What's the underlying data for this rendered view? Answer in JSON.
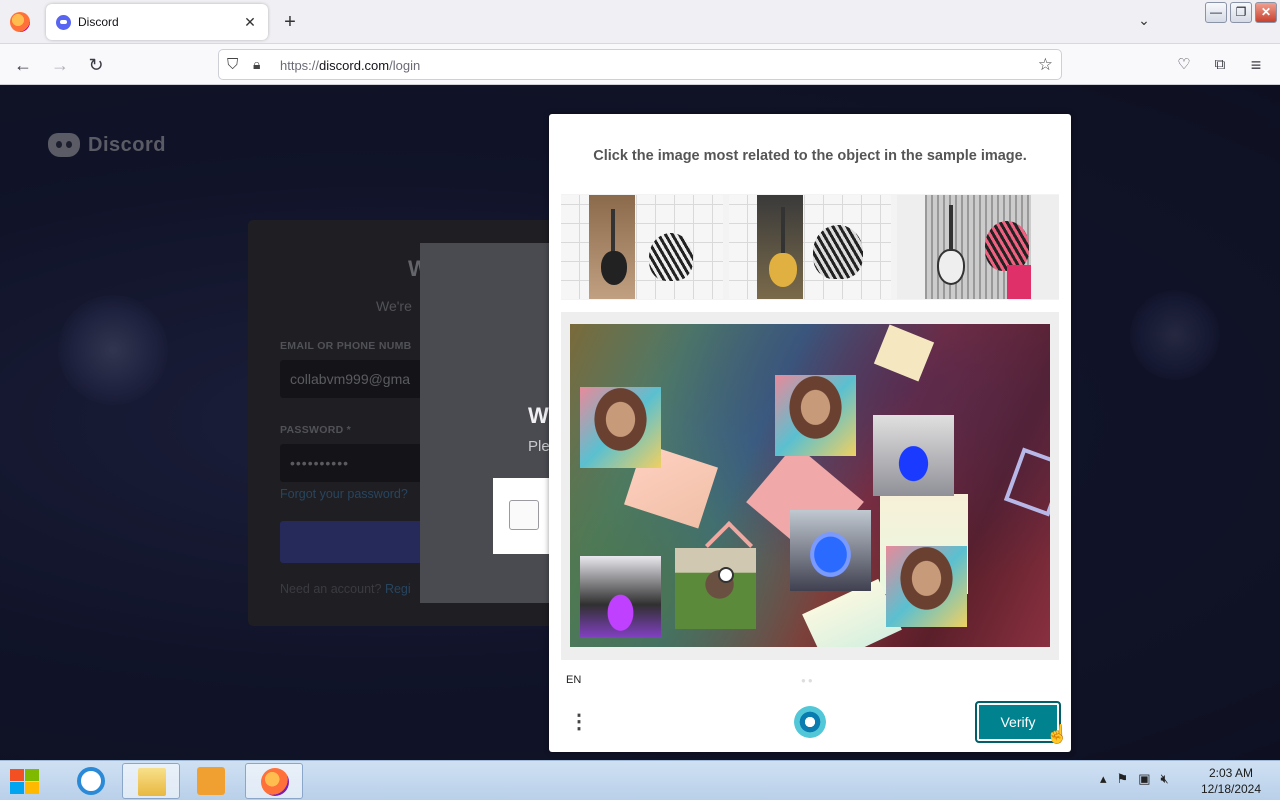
{
  "browser": {
    "tab_title": "Discord",
    "tab_close": "✕",
    "new_tab": "+",
    "url_prefix": "https://",
    "url_domain": "discord.com",
    "url_path": "/login"
  },
  "page": {
    "brand": "Discord",
    "login": {
      "title": "W",
      "subtitle": "We're",
      "email_label": "EMAIL OR PHONE NUMB",
      "email_value": "collabvm999@gma",
      "password_label": "PASSWORD *",
      "password_value": "••••••••••",
      "forgot": "Forgot your password?",
      "need_account": "Need an account?",
      "register": "Regi"
    },
    "overlay": {
      "title": "W",
      "subtitle": "Ple"
    }
  },
  "challenge": {
    "prompt": "Click the image most related to the object in the sample image.",
    "language": "EN",
    "verify_label": "Verify",
    "menu_icon": "⋮",
    "colors": {
      "verify": "#00838f",
      "accent": "#0a7cb0"
    }
  },
  "taskbar": {
    "time": "2:03 AM",
    "date": "12/18/2024"
  }
}
